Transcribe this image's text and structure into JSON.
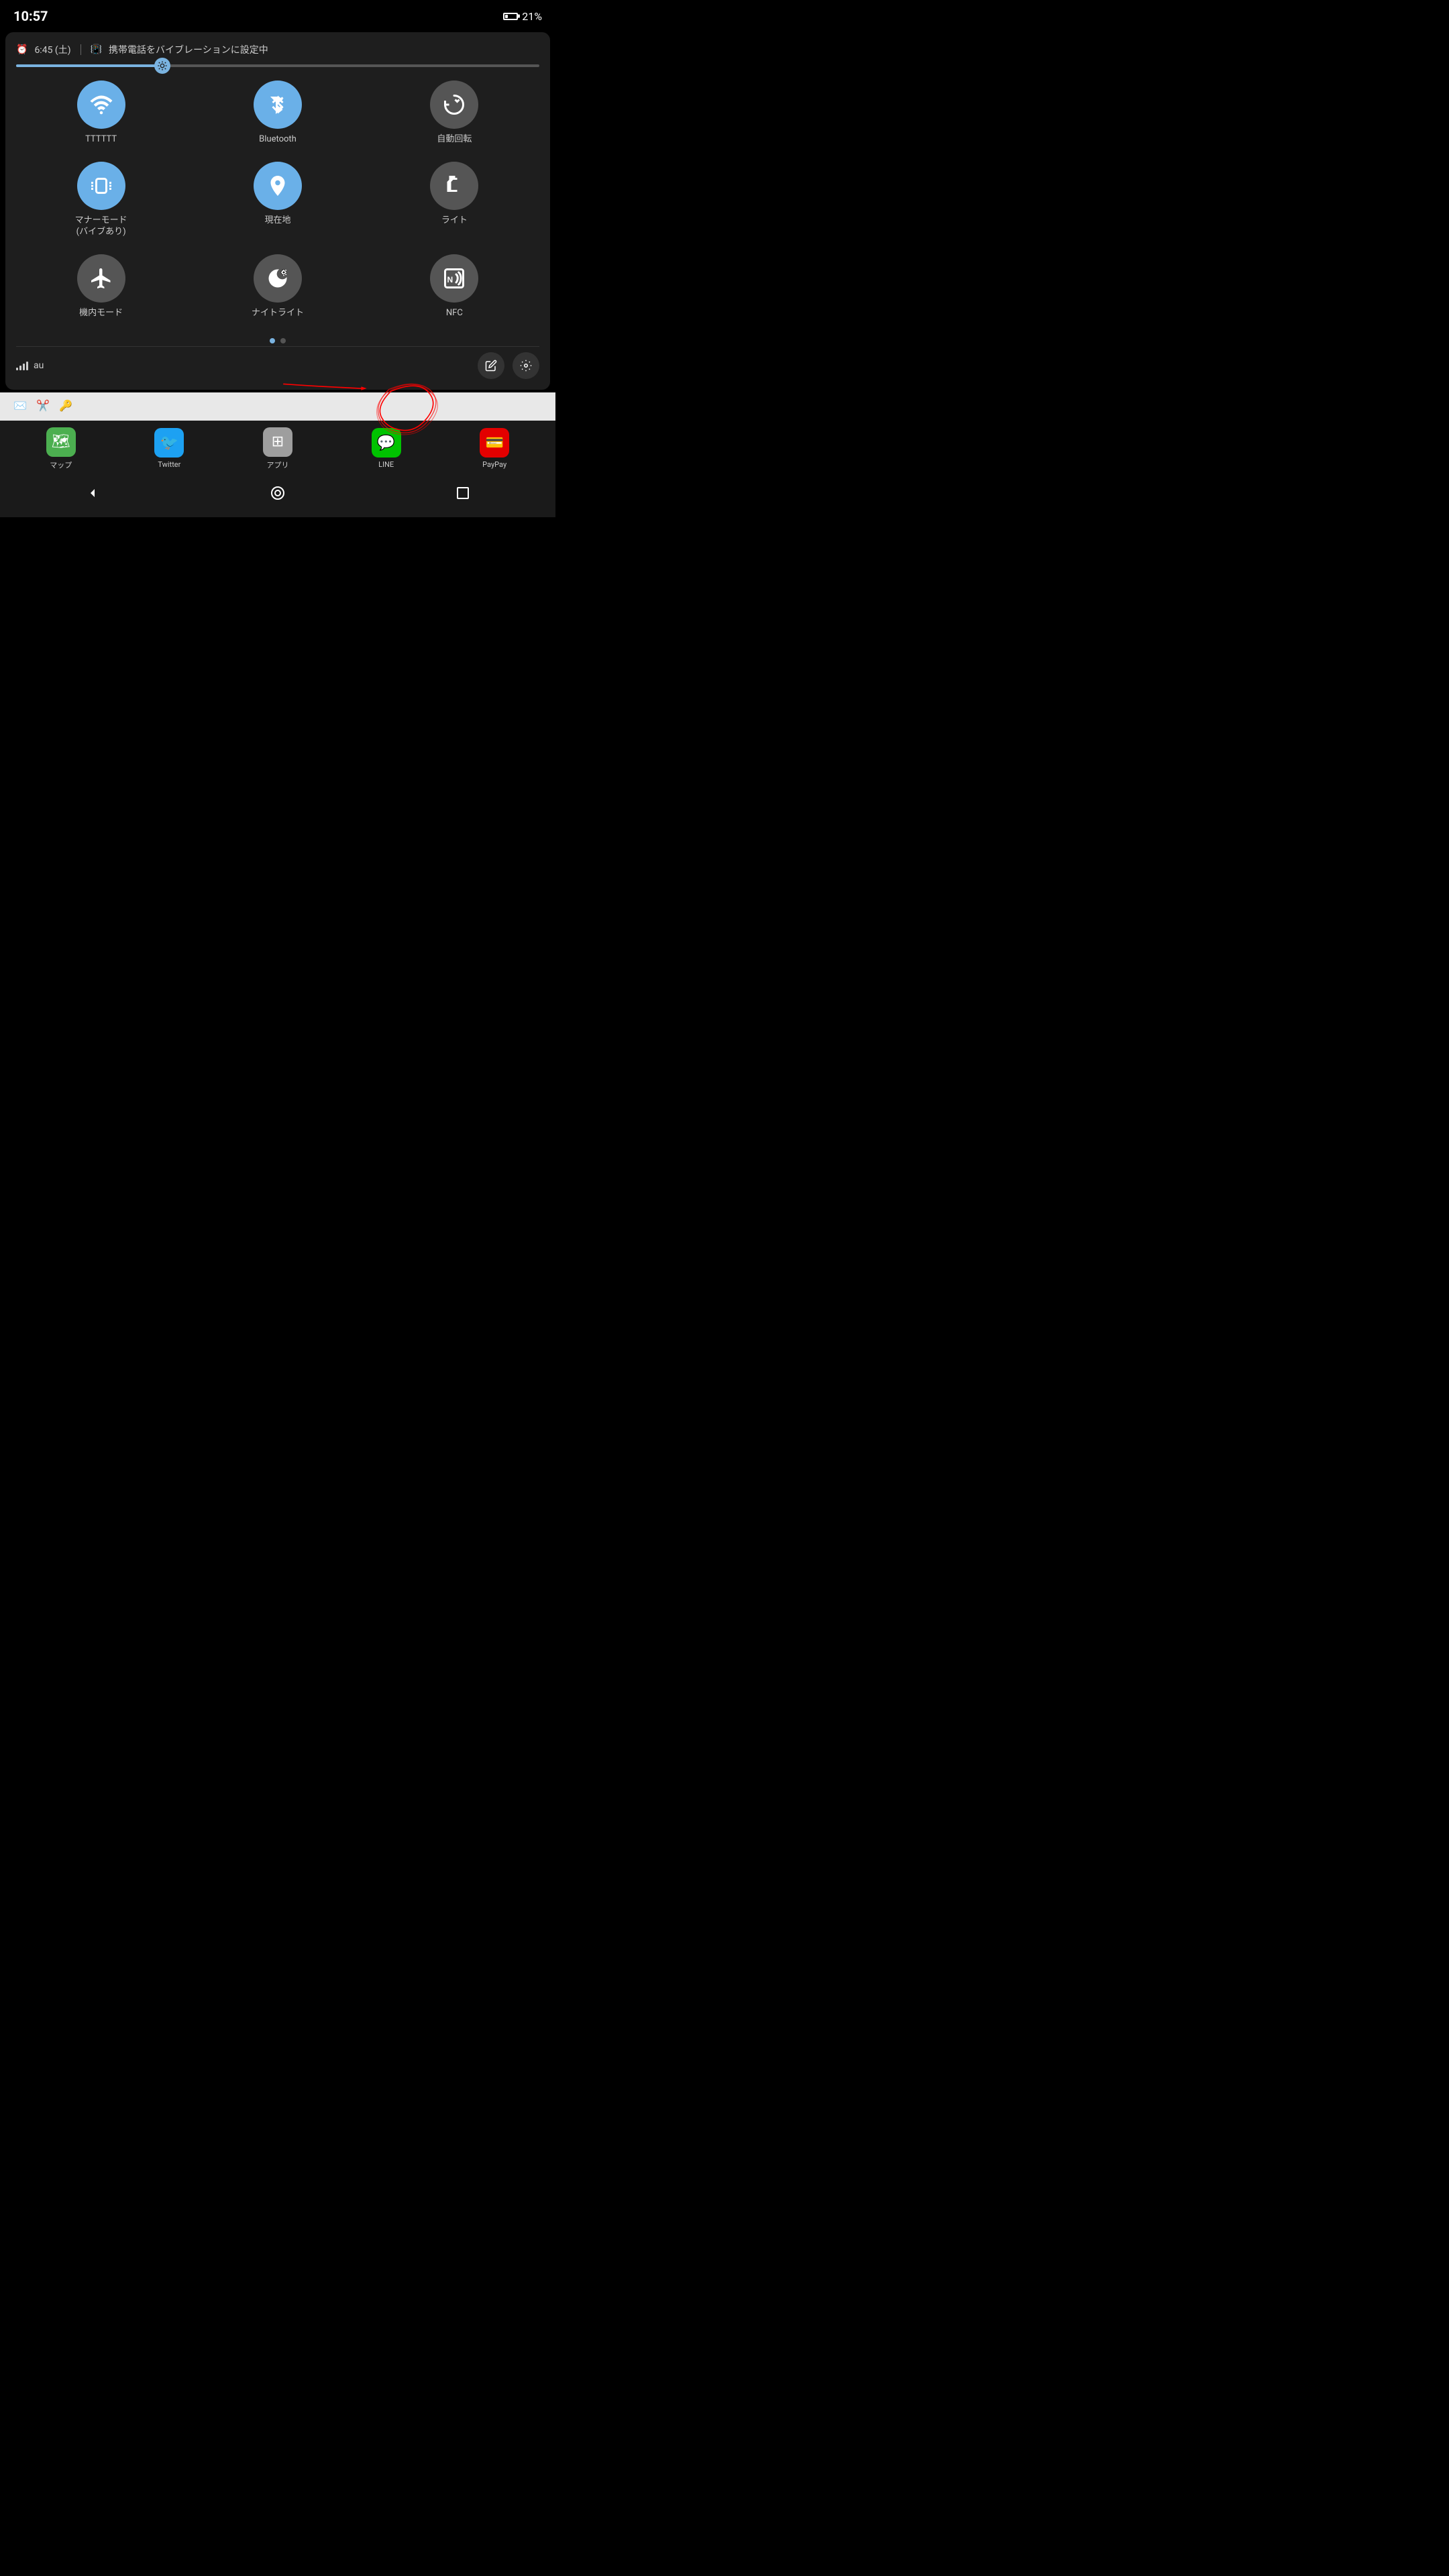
{
  "statusBar": {
    "time": "10:57",
    "batteryPercent": "21%"
  },
  "notification": {
    "alarmTime": "6:45 (土)",
    "vibrationText": "携帯電話をバイブレーションに設定中"
  },
  "tiles": [
    {
      "id": "wifi",
      "label": "TTTTTT",
      "active": true
    },
    {
      "id": "bluetooth",
      "label": "Bluetooth",
      "active": true
    },
    {
      "id": "autorotate",
      "label": "自動回転",
      "active": false
    },
    {
      "id": "vibrate",
      "label": "マナーモード\n(バイブあり)",
      "active": true
    },
    {
      "id": "location",
      "label": "現在地",
      "active": true
    },
    {
      "id": "flashlight",
      "label": "ライト",
      "active": false
    },
    {
      "id": "airplane",
      "label": "機内モード",
      "active": false
    },
    {
      "id": "nightlight",
      "label": "ナイトライト",
      "active": false
    },
    {
      "id": "nfc",
      "label": "NFC",
      "active": false
    }
  ],
  "carrierName": "au",
  "bottomApps": [
    {
      "label": "マップ",
      "color": "#4CAF50",
      "emoji": "🗺"
    },
    {
      "label": "Twitter",
      "color": "#1DA1F2",
      "emoji": "🐦"
    },
    {
      "label": "アプリ",
      "color": "#9E9E9E",
      "emoji": "⊞"
    },
    {
      "label": "LINE",
      "color": "#00C300",
      "emoji": "💬"
    },
    {
      "label": "PayPay",
      "color": "#E30000",
      "emoji": "💳"
    }
  ],
  "taskbarIcons": [
    "✉",
    "✂",
    "🔑"
  ],
  "editButtonLabel": "✏",
  "settingsButtonLabel": "⚙"
}
